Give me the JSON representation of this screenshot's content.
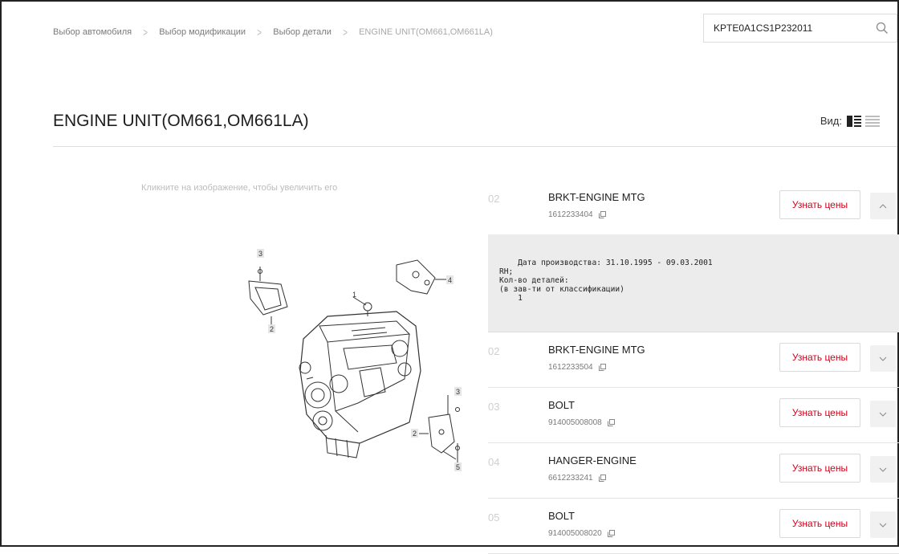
{
  "breadcrumb": {
    "items": [
      "Выбор автомобиля",
      "Выбор модификации",
      "Выбор детали"
    ],
    "current": "ENGINE UNIT(OM661,OM661LA)"
  },
  "search": {
    "value": "KPTE0A1CS1P232011"
  },
  "page": {
    "title": "ENGINE UNIT(OM661,OM661LA)"
  },
  "view": {
    "label": "Вид:"
  },
  "image": {
    "hint": "Кликните на изображение, чтобы увеличить его",
    "callouts": [
      "1",
      "2",
      "3",
      "4",
      "2",
      "3",
      "5"
    ]
  },
  "parts": [
    {
      "num": "02",
      "name": "BRKT-ENGINE MTG",
      "code": "1612233404",
      "button": "Узнать цены",
      "expanded": true
    },
    {
      "num": "02",
      "name": "BRKT-ENGINE MTG",
      "code": "1612233504",
      "button": "Узнать цены",
      "expanded": false
    },
    {
      "num": "03",
      "name": "BOLT",
      "code": "914005008008",
      "button": "Узнать цены",
      "expanded": false
    },
    {
      "num": "04",
      "name": "HANGER-ENGINE",
      "code": "6612233241",
      "button": "Узнать цены",
      "expanded": false
    },
    {
      "num": "05",
      "name": "BOLT",
      "code": "914005008020",
      "button": "Узнать цены",
      "expanded": false
    }
  ],
  "detail": {
    "text": "    Дата производства: 31.10.1995 - 09.03.2001\nRH;\nКол-во деталей:\n(в зав-ти от классификации)\n    1"
  },
  "colors": {
    "accent": "#d0021b",
    "detail_bg": "#ececec",
    "button_bg": "#f1f1f1"
  }
}
